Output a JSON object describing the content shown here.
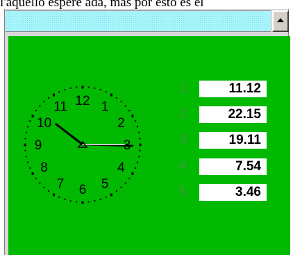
{
  "top_text": "l'aquello espere ada, mas por esto es el",
  "clock": {
    "numerals": [
      "12",
      "1",
      "2",
      "3",
      "4",
      "5",
      "6",
      "7",
      "8",
      "9",
      "10",
      "11"
    ],
    "time": {
      "hour": 10,
      "minute": 15,
      "second": 15
    }
  },
  "readings": [
    {
      "index": "1",
      "value": "11.12"
    },
    {
      "index": "2",
      "value": "22.15"
    },
    {
      "index": "3",
      "value": "19.11"
    },
    {
      "index": "4",
      "value": "7.54"
    },
    {
      "index": "5",
      "value": "3.46"
    }
  ],
  "colors": {
    "panel": "#00c000",
    "title_bar": "#aaf4fb",
    "index_text": "#3f9a3f",
    "value_box": "#ffffff"
  },
  "icons": {
    "scroll_up": "up-arrow-icon"
  }
}
